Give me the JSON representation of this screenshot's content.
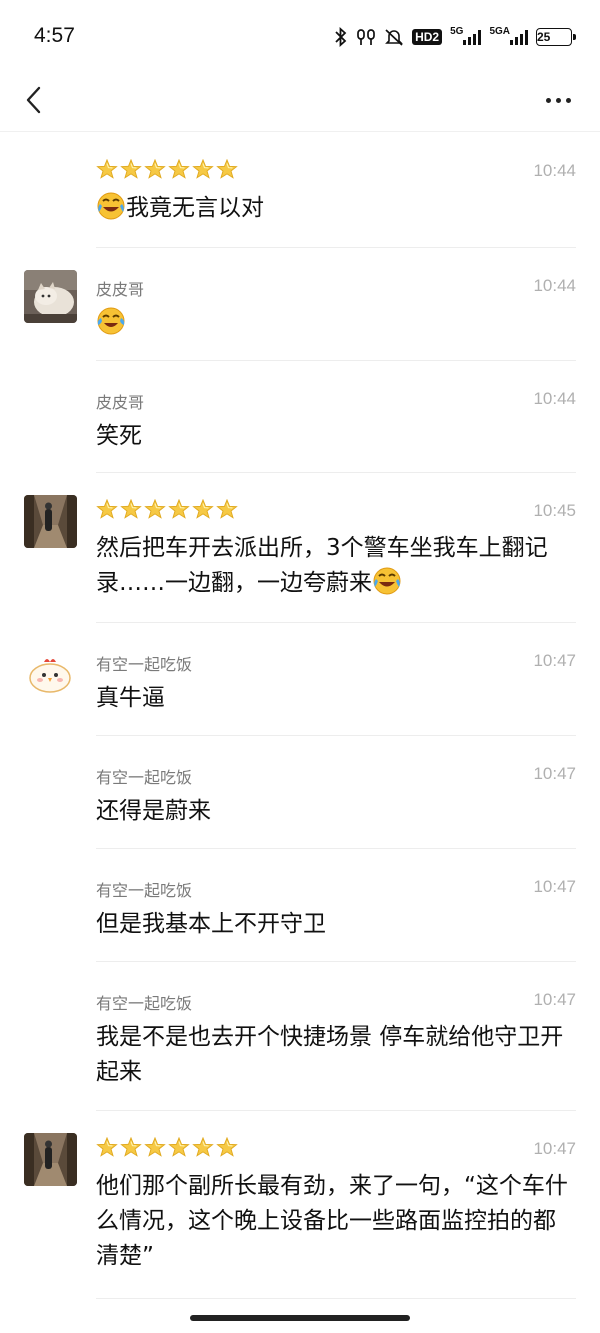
{
  "status_bar": {
    "time": "4:57",
    "hd": "HD2",
    "net1": "5G",
    "net2": "5GA",
    "battery": "25"
  },
  "nav": {
    "back_icon": "chevron-left-icon",
    "more_icon": "more-dots-icon"
  },
  "messages": [
    {
      "sender": "🌟🌟🌟🌟🌟🌟",
      "time": "10:44",
      "text": "我竟无言以对",
      "emoji": "rolling-laughing-icon",
      "avatar": null
    },
    {
      "sender": "皮皮哥",
      "time": "10:44",
      "text": "",
      "emoji": "tears-of-joy-icon",
      "avatar": "cat-avatar"
    },
    {
      "sender": "皮皮哥",
      "time": "10:44",
      "text": "笑死",
      "avatar": null
    },
    {
      "sender": "🌟🌟🌟🌟🌟🌟",
      "time": "10:45",
      "text": "然后把车开去派出所，3个警车坐我车上翻记录……一边翻，一边夸蔚来",
      "emoji": "rolling-laughing-icon",
      "avatar": "hallway-avatar"
    },
    {
      "sender": "有空一起吃饭",
      "time": "10:47",
      "text": "真牛逼",
      "avatar": "chick-avatar"
    },
    {
      "sender": "有空一起吃饭",
      "time": "10:47",
      "text": "还得是蔚来",
      "avatar": null
    },
    {
      "sender": "有空一起吃饭",
      "time": "10:47",
      "text": "但是我基本上不开守卫",
      "avatar": null
    },
    {
      "sender": "有空一起吃饭",
      "time": "10:47",
      "text": "我是不是也去开个快捷场景  停车就给他守卫开起来",
      "avatar": null
    },
    {
      "sender": "🌟🌟🌟🌟🌟🌟",
      "time": "10:47",
      "text": "他们那个副所长最有劲，来了一句，“这个车什么情况，这个晚上设备比一些路面监控拍的都清楚”",
      "avatar": "hallway-avatar"
    }
  ],
  "colors": {
    "timestamp": "#b0b0b0",
    "sender": "#7a7a7a",
    "divider": "#ededed",
    "star_fill": "#f6c945"
  }
}
